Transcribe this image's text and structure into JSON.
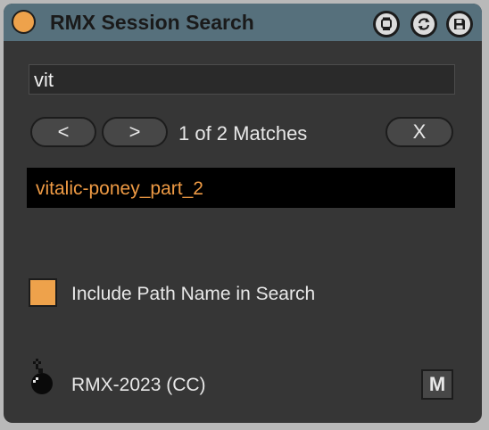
{
  "window": {
    "title": "RMX Session Search",
    "icons": [
      "device-power-icon",
      "window-icon",
      "refresh-icon",
      "save-icon"
    ]
  },
  "search": {
    "value": "vit",
    "placeholder": ""
  },
  "nav": {
    "prev_label": "<",
    "next_label": ">",
    "matches_text": "1 of 2 Matches",
    "clear_label": "X"
  },
  "results": [
    {
      "label": "vitalic-poney_part_2"
    }
  ],
  "options": {
    "include_path_label": "Include Path Name in Search",
    "include_path_checked": true
  },
  "footer": {
    "brand": "RMX-2023 (CC)",
    "m_label": "M"
  },
  "colors": {
    "accent": "#eea24b",
    "titlebar": "#56707c",
    "background": "#363636",
    "result_background": "#000000",
    "result_text": "#ee9a44"
  }
}
